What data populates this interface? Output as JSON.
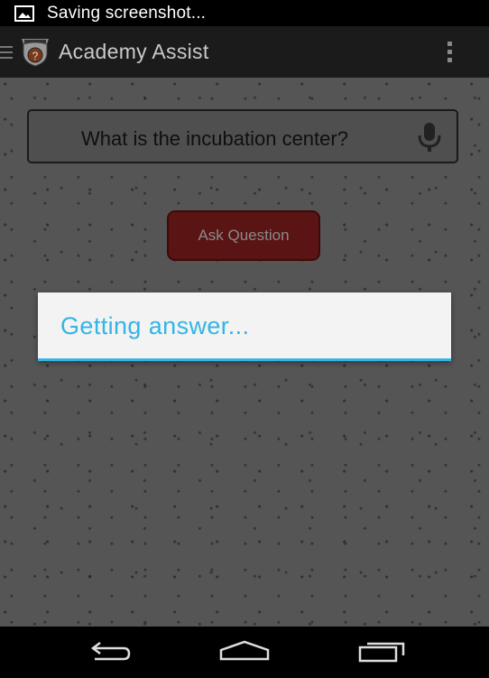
{
  "status_bar": {
    "notification_icon": "image-icon",
    "text": "Saving screenshot..."
  },
  "action_bar": {
    "drawer_icon": "drawer-icon",
    "logo_icon": "academy-badge-logo",
    "title": "Academy Assist",
    "overflow_icon": "overflow-menu-icon"
  },
  "question": {
    "value": "What is the incubation center?",
    "mic_icon": "microphone-icon"
  },
  "ask_button": {
    "label": "Ask Question",
    "color": "#5a1414"
  },
  "dialog": {
    "message": "Getting answer...",
    "accent_color": "#33b5e5"
  },
  "nav_bar": {
    "back_icon": "back-icon",
    "home_icon": "home-icon",
    "recents_icon": "recents-icon"
  }
}
